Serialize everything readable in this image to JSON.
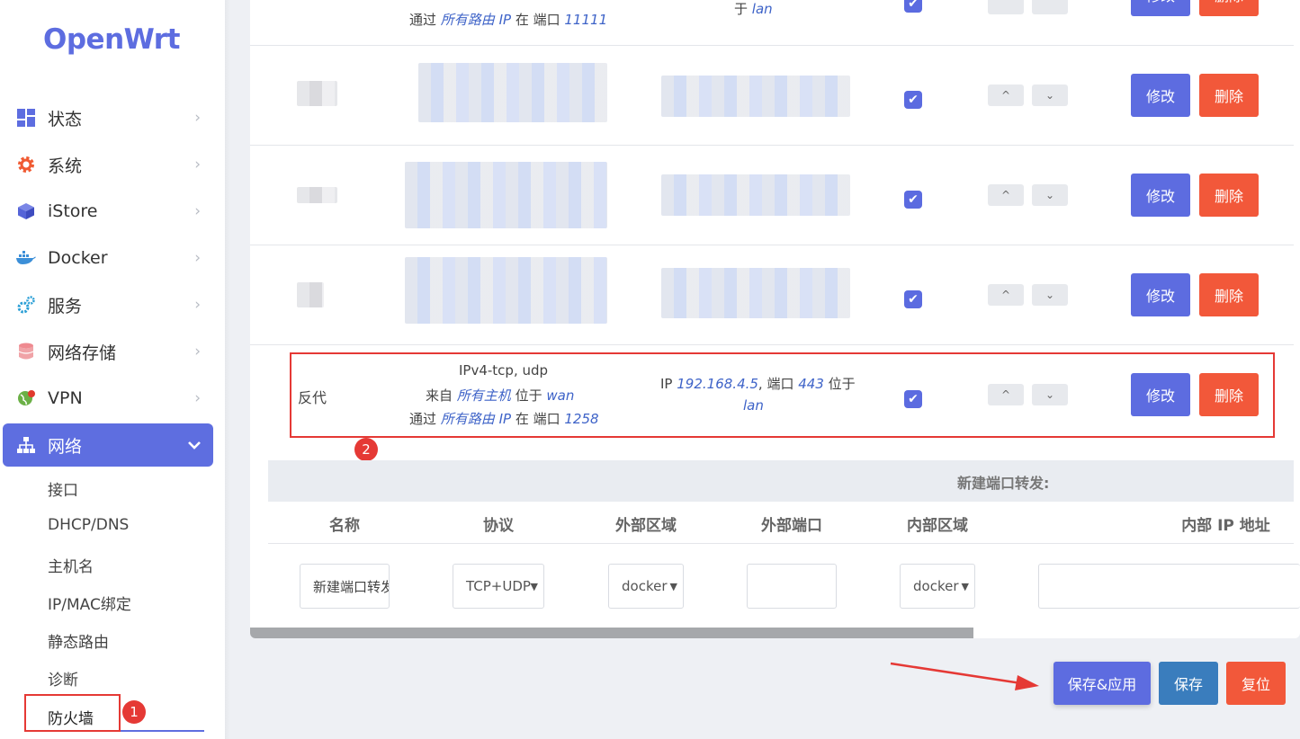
{
  "sidebar": {
    "logo": "OpenWrt",
    "items": [
      {
        "label": "状态",
        "icon": "dashboard-icon"
      },
      {
        "label": "系统",
        "icon": "gear-icon"
      },
      {
        "label": "iStore",
        "icon": "cube-icon"
      },
      {
        "label": "Docker",
        "icon": "docker-whale-icon"
      },
      {
        "label": "服务",
        "icon": "services-gears-icon"
      },
      {
        "label": "网络存储",
        "icon": "database-icon"
      },
      {
        "label": "VPN",
        "icon": "vpn-globe-icon"
      },
      {
        "label": "网络",
        "icon": "network-tree-icon",
        "active": true
      }
    ],
    "network_sub": [
      "接口",
      "DHCP/DNS",
      "主机名",
      "IP/MAC绑定",
      "静态路由",
      "诊断",
      "防火墙"
    ]
  },
  "top_row": {
    "line2": "通过",
    "line2_via": "所有路由 IP",
    "line2_mid": "在 端口",
    "line2_port": "11111",
    "dest_tail_prefix": "于",
    "dest_tail_zone": "lan"
  },
  "rules": [
    {
      "name": "反代",
      "proto": "IPv4-tcp, udp",
      "from_prefix": "来自",
      "from_host": "所有主机",
      "from_mid": "位于",
      "from_zone": "wan",
      "via_prefix": "通过",
      "via_ip": "所有路由 IP",
      "via_mid": "在 端口",
      "via_port": "1258",
      "dest_prefix": "IP",
      "dest_ip": "192.168.4.5",
      "dest_mid": ", 端口",
      "dest_port": "443",
      "dest_suffix": "位于",
      "dest_zone": "lan"
    }
  ],
  "row_actions": {
    "edit": "修改",
    "delete": "删除",
    "up": "^",
    "down": "⌄",
    "check": "✔"
  },
  "annotations": {
    "badge1": "1",
    "badge2": "2"
  },
  "new_forward": {
    "title": "新建端口转发:",
    "columns": [
      "名称",
      "协议",
      "外部区域",
      "外部端口",
      "内部区域",
      "内部 IP 地址"
    ],
    "name_placeholder": "新建端口转发",
    "protocol": "TCP+UDP",
    "ext_zone": "docker",
    "ext_port": "",
    "int_zone": "docker",
    "int_ip": ""
  },
  "footer": {
    "save_apply": "保存&应用",
    "save": "保存",
    "reset": "复位"
  },
  "colors": {
    "accent": "#5e6ee0",
    "danger": "#f2583a",
    "save": "#3a7dbd",
    "highlight": "#e53935"
  }
}
